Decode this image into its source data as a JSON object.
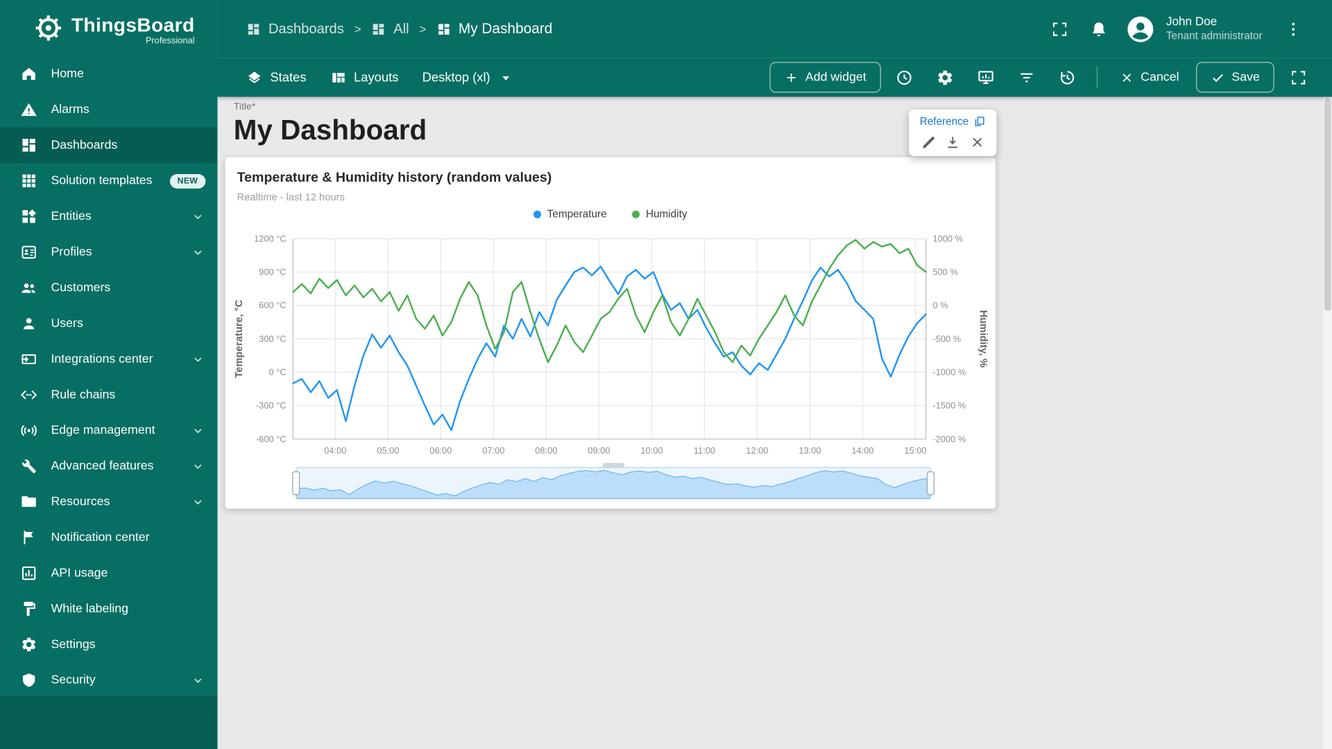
{
  "app": {
    "name": "ThingsBoard",
    "edition": "Professional"
  },
  "header": {
    "breadcrumb": [
      {
        "label": "Dashboards"
      },
      {
        "label": "All"
      },
      {
        "label": "My Dashboard"
      }
    ],
    "separator": ">",
    "user": {
      "name": "John Doe",
      "role": "Tenant administrator"
    }
  },
  "toolbar": {
    "states_label": "States",
    "layouts_label": "Layouts",
    "layout_selected": "Desktop (xl)",
    "add_widget_label": "Add widget",
    "cancel_label": "Cancel",
    "save_label": "Save"
  },
  "sidebar": {
    "items": [
      {
        "label": "Home"
      },
      {
        "label": "Alarms"
      },
      {
        "label": "Dashboards",
        "active": true
      },
      {
        "label": "Solution templates",
        "badge": "NEW"
      },
      {
        "label": "Entities",
        "expandable": true
      },
      {
        "label": "Profiles",
        "expandable": true
      },
      {
        "label": "Customers"
      },
      {
        "label": "Users"
      },
      {
        "label": "Integrations center",
        "expandable": true
      },
      {
        "label": "Rule chains"
      },
      {
        "label": "Edge management",
        "expandable": true
      },
      {
        "label": "Advanced features",
        "expandable": true
      },
      {
        "label": "Resources",
        "expandable": true
      },
      {
        "label": "Notification center"
      },
      {
        "label": "API usage"
      },
      {
        "label": "White labeling"
      },
      {
        "label": "Settings"
      },
      {
        "label": "Security",
        "expandable": true
      }
    ]
  },
  "page": {
    "title_label": "Title*",
    "title_value": "My Dashboard"
  },
  "widget_panel": {
    "reference_label": "Reference"
  },
  "widget": {
    "title": "Temperature & Humidity history (random values)",
    "subtitle": "Realtime - last 12 hours"
  },
  "icons": {
    "logo": "gear",
    "breadcrumb_item": "dashboard-grid",
    "header": [
      "fullscreen",
      "notifications-bell",
      "avatar",
      "kebab-menu"
    ],
    "toolbar": [
      "layers",
      "view-columns",
      "caret-down",
      "plus",
      "clock",
      "gear",
      "display-chart",
      "filter",
      "history",
      "close",
      "check",
      "fullscreen"
    ],
    "widget_panel": [
      "copy",
      "pencil",
      "download",
      "close"
    ]
  },
  "colors": {
    "teal": "#076e63",
    "temperature": "#2196f3",
    "humidity": "#4caf50",
    "reference_blue": "#1976d2"
  },
  "chart_data": {
    "type": "line",
    "title": "Temperature & Humidity history (random values)",
    "subtitle": "Realtime - last 12 hours",
    "legend_position": "top",
    "grid": true,
    "x_ticks": [
      "04:00",
      "05:00",
      "06:00",
      "07:00",
      "08:00",
      "09:00",
      "10:00",
      "11:00",
      "12:00",
      "13:00",
      "14:00",
      "15:00"
    ],
    "x_tick_minutes": [
      240,
      300,
      360,
      420,
      480,
      540,
      600,
      660,
      720,
      780,
      840,
      900
    ],
    "x_range_minutes": [
      192,
      912
    ],
    "left_axis": {
      "label": "Temperature, °C",
      "unit": "°C",
      "ticks": [
        1200,
        900,
        600,
        300,
        0,
        -300,
        -600
      ],
      "range": [
        -600,
        1200
      ]
    },
    "right_axis": {
      "label": "Humidity, %",
      "unit": "%",
      "ticks": [
        1000,
        500,
        0,
        -500,
        -1000,
        -1500,
        -2000
      ],
      "range": [
        -2000,
        1000
      ]
    },
    "x_minutes": [
      192,
      202,
      212,
      222,
      232,
      242,
      252,
      262,
      272,
      282,
      292,
      302,
      312,
      322,
      332,
      342,
      352,
      362,
      372,
      382,
      392,
      402,
      412,
      422,
      432,
      442,
      452,
      462,
      472,
      482,
      492,
      502,
      512,
      522,
      532,
      542,
      552,
      562,
      572,
      582,
      592,
      602,
      612,
      622,
      632,
      642,
      652,
      662,
      672,
      682,
      692,
      702,
      712,
      722,
      732,
      742,
      752,
      762,
      772,
      782,
      792,
      802,
      812,
      822,
      832,
      842,
      852,
      862,
      872,
      882,
      892,
      902,
      912
    ],
    "series": [
      {
        "name": "Temperature",
        "color": "#2196f3",
        "axis": "left",
        "values": [
          -100,
          -60,
          -180,
          -80,
          -230,
          -160,
          -440,
          -120,
          150,
          340,
          220,
          330,
          180,
          60,
          -120,
          -300,
          -470,
          -380,
          -520,
          -260,
          -60,
          120,
          260,
          140,
          420,
          300,
          480,
          320,
          540,
          420,
          650,
          780,
          900,
          940,
          870,
          950,
          820,
          700,
          860,
          920,
          840,
          900,
          700,
          560,
          620,
          480,
          560,
          400,
          260,
          140,
          180,
          60,
          -20,
          80,
          20,
          160,
          300,
          480,
          640,
          820,
          940,
          860,
          920,
          800,
          640,
          560,
          480,
          120,
          -40,
          160,
          320,
          440,
          520
        ]
      },
      {
        "name": "Humidity",
        "color": "#4caf50",
        "axis": "right",
        "values": [
          200,
          320,
          180,
          400,
          260,
          380,
          150,
          300,
          120,
          250,
          60,
          200,
          -80,
          150,
          -200,
          -350,
          -150,
          -450,
          -250,
          100,
          350,
          150,
          -300,
          -650,
          -400,
          200,
          350,
          -100,
          -500,
          -850,
          -600,
          -300,
          -550,
          -700,
          -450,
          -200,
          -100,
          100,
          250,
          -150,
          -400,
          -100,
          150,
          -250,
          -450,
          -200,
          100,
          -150,
          -400,
          -700,
          -850,
          -600,
          -750,
          -500,
          -300,
          -100,
          150,
          -150,
          -300,
          50,
          300,
          550,
          750,
          900,
          980,
          850,
          950,
          880,
          920,
          780,
          850,
          600,
          500
        ]
      }
    ]
  }
}
